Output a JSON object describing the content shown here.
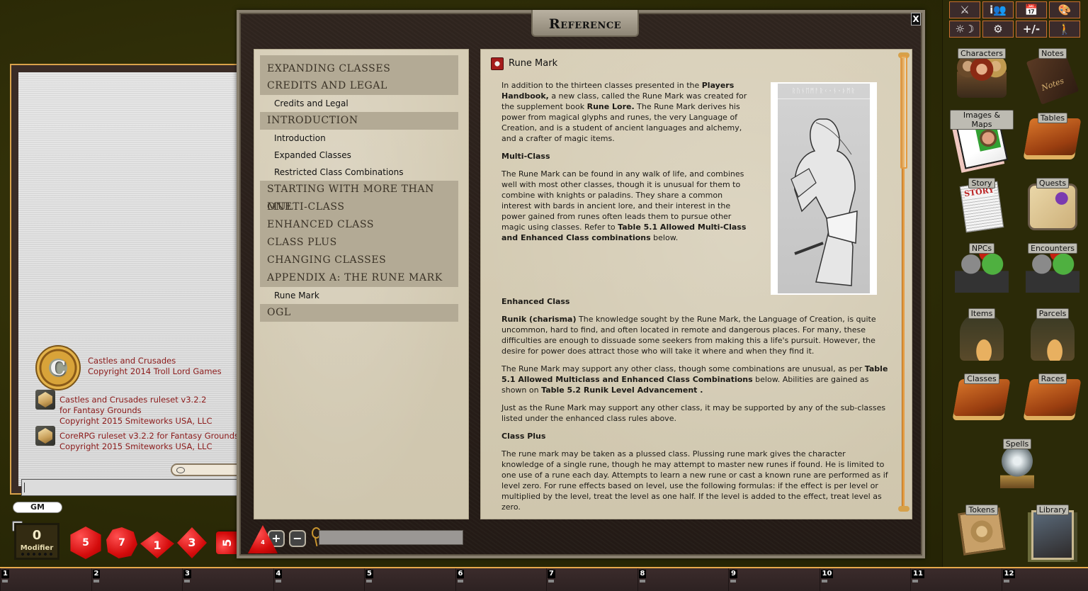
{
  "chat": {
    "entries": [
      {
        "lines": [
          "Castles and Crusades",
          "Copyright 2014 Troll Lord Games"
        ],
        "icon": "castles-crusades-logo"
      },
      {
        "lines": [
          "Castles and Crusades ruleset v3.2.2",
          "for Fantasy Grounds",
          "Copyright 2015 Smiteworks USA, LLC"
        ],
        "icon": "ruleset-gem-icon"
      },
      {
        "lines": [
          "CoreRPG ruleset v3.2.2 for Fantasy Grounds",
          "Copyright 2015 Smiteworks USA, LLC"
        ],
        "icon": "ruleset-gem-icon"
      }
    ],
    "input_value": ""
  },
  "identity": {
    "gm_label": "GM"
  },
  "modifier": {
    "value": "0",
    "label": "Modifier"
  },
  "dice": [
    {
      "type": "d20",
      "face": "5"
    },
    {
      "type": "d12",
      "face": "7"
    },
    {
      "type": "d10",
      "face": "1"
    },
    {
      "type": "d8",
      "face": "3"
    },
    {
      "type": "d6",
      "face": "5"
    },
    {
      "type": "d4",
      "face": "4"
    }
  ],
  "hotkeys": [
    "1",
    "2",
    "3",
    "4",
    "5",
    "6",
    "7",
    "8",
    "9",
    "10",
    "11",
    "12"
  ],
  "reference": {
    "title": "Reference",
    "close_label": "X",
    "toc": [
      {
        "kind": "section",
        "label": "Expanding Classes"
      },
      {
        "kind": "section",
        "label": "Credits and Legal"
      },
      {
        "kind": "item",
        "label": "Credits and Legal"
      },
      {
        "kind": "section",
        "label": "Introduction"
      },
      {
        "kind": "item",
        "label": "Introduction"
      },
      {
        "kind": "item",
        "label": "Expanded Classes"
      },
      {
        "kind": "item",
        "label": "Restricted Class Combinations"
      },
      {
        "kind": "section",
        "label": "Starting with more than one"
      },
      {
        "kind": "section",
        "label": "Multi-Class"
      },
      {
        "kind": "section",
        "label": "Enhanced Class"
      },
      {
        "kind": "section",
        "label": "Class Plus"
      },
      {
        "kind": "section",
        "label": "Changing Classes"
      },
      {
        "kind": "section",
        "label": "Appendix A: The Rune Mark"
      },
      {
        "kind": "item",
        "label": "Rune Mark"
      },
      {
        "kind": "section",
        "label": "OGL"
      }
    ],
    "page": {
      "title": "Rune Mark",
      "illustration_runes": "ᚱᚢᚾᛖᛗᚨᚱᚲ·ᚾ·ᚦᛗᚱ",
      "blocks": [
        {
          "type": "para",
          "narrow": true,
          "parts": [
            {
              "t": "In addition to the thirteen classes presented in the "
            },
            {
              "t": "Players Handbook,",
              "b": true
            },
            {
              "t": " a new class, called the Rune Mark was created for the supplement book "
            },
            {
              "t": "Rune Lore.",
              "b": true
            },
            {
              "t": " The Rune Mark derives his power from magical glyphs and runes, the very Language of Creation, and is a student of ancient languages and alchemy, and a crafter of magic items."
            }
          ]
        },
        {
          "type": "heading",
          "text": "Multi-Class"
        },
        {
          "type": "para",
          "narrow": true,
          "parts": [
            {
              "t": "The Rune Mark can be found in any walk of life, and combines well with most other classes, though it is unusual for them to combine with knights or paladins. They share a common interest with bards in ancient lore, and their interest in the power gained from runes often leads them to pursue other magic using classes. Refer to "
            },
            {
              "t": "Table 5.1 Allowed Multi-Class and Enhanced Class combinations",
              "b": true
            },
            {
              "t": " below."
            }
          ]
        },
        {
          "type": "spacer"
        },
        {
          "type": "heading",
          "text": "Enhanced Class"
        },
        {
          "type": "para",
          "parts": [
            {
              "t": "Runik (charisma)",
              "b": true
            },
            {
              "t": " The knowledge sought by the Rune Mark, the Language of Creation, is quite uncommon, hard to find, and often located in remote and dangerous places. For many, these difficulties are enough to dissuade some seekers from making this a life's pursuit. However, the desire for power does attract those who will take it where and when they find it."
            }
          ]
        },
        {
          "type": "para",
          "parts": [
            {
              "t": "The Rune Mark may support any other class, though some combinations are unusual, as per "
            },
            {
              "t": "Table 5.1 Allowed Multiclass and Enhanced Class Combinations",
              "b": true
            },
            {
              "t": " below. Abilities are gained as shown on "
            },
            {
              "t": "Table 5.2 Runik Level Advancement .",
              "b": true
            }
          ]
        },
        {
          "type": "para",
          "parts": [
            {
              "t": "Just as the Rune Mark may support any other class, it may be supported by any of the sub-classes listed under the enhanced class rules above."
            }
          ]
        },
        {
          "type": "heading",
          "text": "Class Plus"
        },
        {
          "type": "para",
          "parts": [
            {
              "t": "The rune mark may be taken as a plussed class. Plussing rune mark gives the character knowledge of a single rune, though he may attempt to master new runes if found. He is limited to one use of a rune each day. Attempts to learn a new rune or cast a known rune are performed as if level zero. For rune effects based on level, use the following formulas: if the effect is per level or multiplied by the level, treat the level as one half. If the level is added to the effect, treat level as zero."
            }
          ]
        }
      ]
    },
    "footer": {
      "add_label": "+",
      "remove_label": "−",
      "search_value": ""
    }
  },
  "toolbar": {
    "buttons": [
      {
        "name": "combat-tracker-button",
        "glyph": "⚔"
      },
      {
        "name": "party-sheet-button",
        "glyph": "i👥"
      },
      {
        "name": "calendar-button",
        "glyph": "📅"
      },
      {
        "name": "colors-button",
        "glyph": "🎨"
      },
      {
        "name": "lighting-button",
        "glyph": "☼☽"
      },
      {
        "name": "options-button",
        "glyph": "⚙"
      },
      {
        "name": "modifiers-button",
        "glyph": "+/-"
      },
      {
        "name": "effects-button",
        "glyph": "🚶"
      }
    ]
  },
  "sidebar": {
    "items": [
      {
        "label": "Characters",
        "art": "characters"
      },
      {
        "label": "Notes",
        "art": "notes"
      },
      {
        "label": "Images & Maps",
        "art": "images"
      },
      {
        "label": "Tables",
        "art": "tables"
      },
      {
        "label": "Story",
        "art": "story"
      },
      {
        "label": "Quests",
        "art": "quests"
      },
      {
        "label": "NPCs",
        "art": "npc"
      },
      {
        "label": "Encounters",
        "art": "encounters"
      },
      {
        "label": "Items",
        "art": "items"
      },
      {
        "label": "Parcels",
        "art": "parcels"
      },
      {
        "label": "Classes",
        "art": "classes"
      },
      {
        "label": "Races",
        "art": "races"
      },
      {
        "label": "Spells",
        "art": "spells"
      },
      {
        "label": "Tokens",
        "art": "tokens"
      },
      {
        "label": "Library",
        "art": "library"
      }
    ]
  }
}
